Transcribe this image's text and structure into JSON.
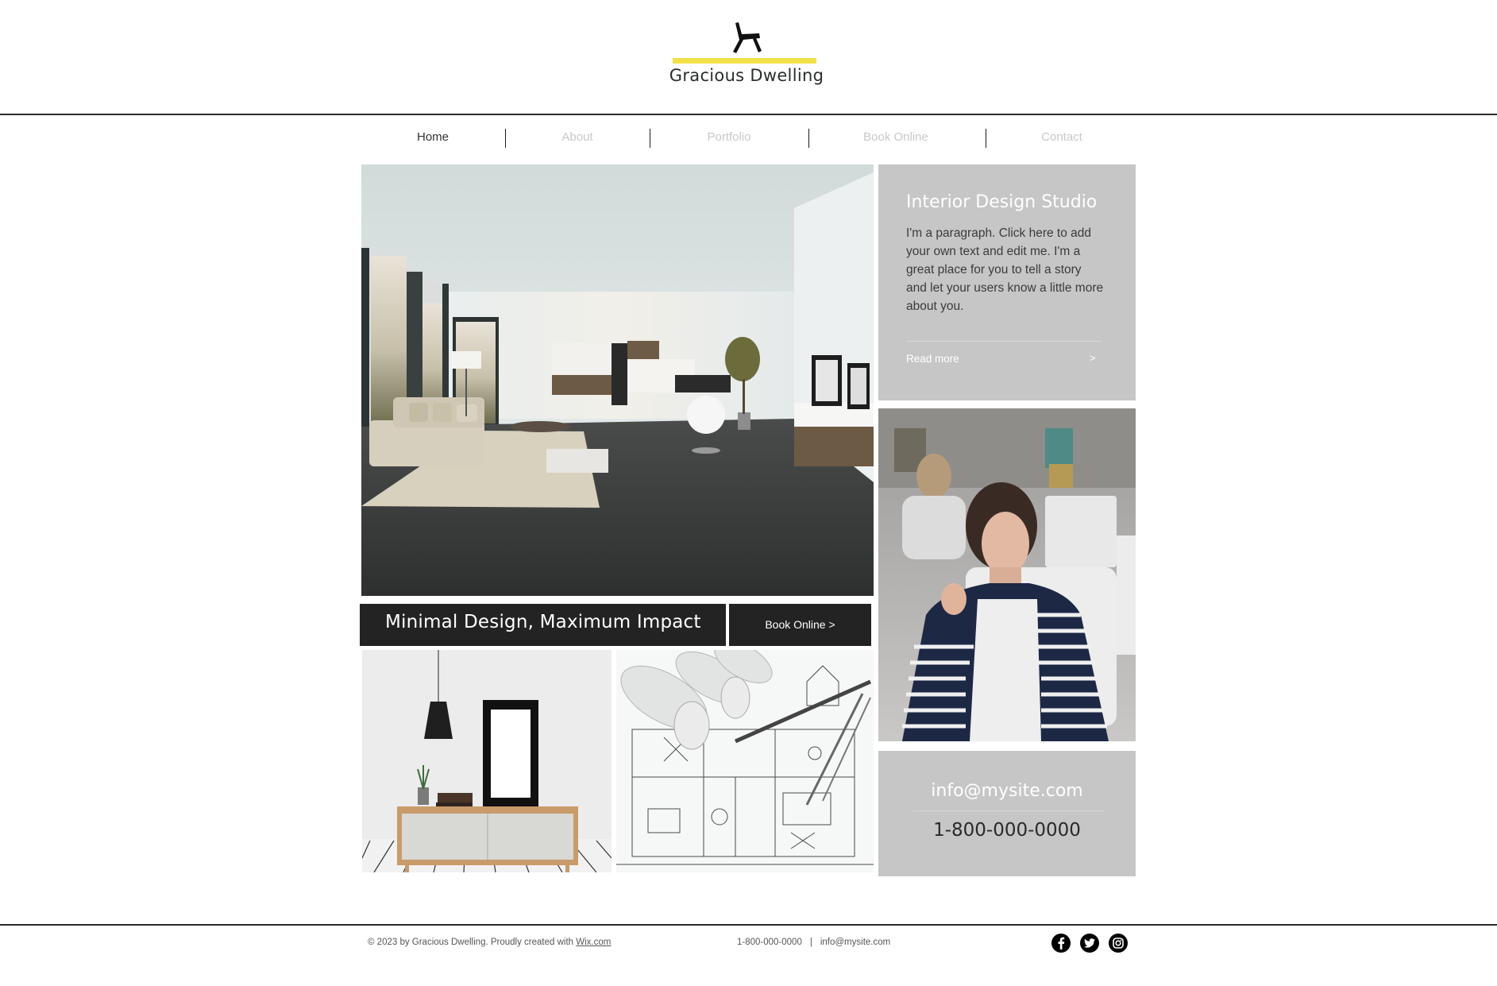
{
  "brand": {
    "name": "Gracious Dwelling",
    "logo_icon": "chair-icon",
    "accent_color": "#f2e04a"
  },
  "nav": {
    "items": [
      {
        "label": "Home",
        "active": true
      },
      {
        "label": "About",
        "active": false
      },
      {
        "label": "Portfolio",
        "active": false
      },
      {
        "label": "Book Online",
        "active": false
      },
      {
        "label": "Contact",
        "active": false
      }
    ]
  },
  "hero": {
    "image_alt": "Minimalist living room with beige sofa, rug and wall shelving"
  },
  "intro_card": {
    "title": "Interior Design Studio",
    "paragraph": "I'm a paragraph. Click here to add your own text and edit me. I'm a great place for you to tell a story and let your users know a little more about you.",
    "read_more": "Read more",
    "arrow": ">",
    "background": "#c6c6c6"
  },
  "banner": {
    "title": "Minimal Design, Maximum Impact",
    "button_label": "Book Online >",
    "background": "#232323"
  },
  "gallery": {
    "portrait_alt": "Smiling woman in striped blazer in office",
    "sideboard_alt": "Wooden sideboard with black frame and pendant lamp",
    "blueprint_alt": "Architectural blueprints with rolled plans and compass"
  },
  "contact_card": {
    "email": "info@mysite.com",
    "phone": "1-800-000-0000"
  },
  "footer": {
    "copyright_prefix": "© 2023 by Gracious Dwelling. Proudly created with ",
    "copyright_link": "Wix.com",
    "phone": "1-800-000-0000",
    "separator": "|",
    "email": "info@mysite.com",
    "social": [
      {
        "name": "facebook",
        "icon": "facebook-icon"
      },
      {
        "name": "twitter",
        "icon": "twitter-icon"
      },
      {
        "name": "instagram",
        "icon": "instagram-icon"
      }
    ]
  }
}
